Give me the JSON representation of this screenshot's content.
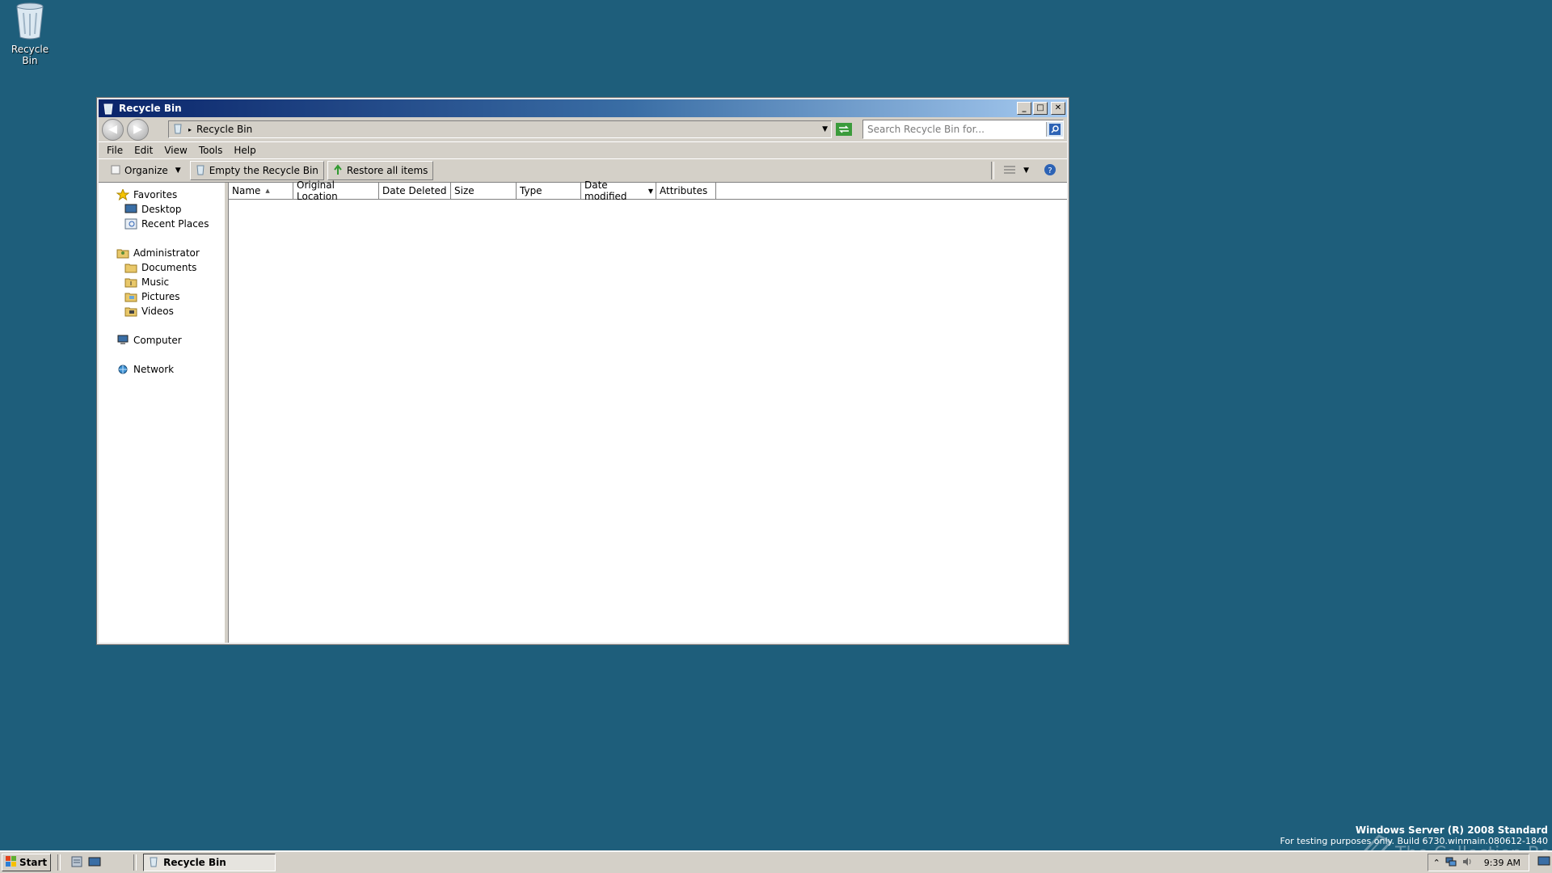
{
  "desktop": {
    "icons": [
      {
        "label": "Recycle Bin",
        "icon": "recycle-bin-icon"
      }
    ],
    "watermark_line1": "Windows Server (R) 2008 Standard",
    "watermark_line2": "For testing purposes only. Build 6730.winmain.080612-1840",
    "brand_text": "The Collection Book"
  },
  "window": {
    "title": "Recycle Bin",
    "controls": {
      "minimize": "_",
      "maximize": "□",
      "close": "✕"
    },
    "address": {
      "text": "Recycle Bin"
    },
    "search": {
      "placeholder": "Search Recycle Bin for..."
    },
    "menu": [
      "File",
      "Edit",
      "View",
      "Tools",
      "Help"
    ],
    "toolbar": {
      "organize": "Organize",
      "empty": "Empty the Recycle Bin",
      "restore": "Restore all items"
    },
    "nav": {
      "favorites": "Favorites",
      "desktop": "Desktop",
      "recent": "Recent Places",
      "administrator": "Administrator",
      "documents": "Documents",
      "music": "Music",
      "pictures": "Pictures",
      "videos": "Videos",
      "computer": "Computer",
      "network": "Network"
    },
    "columns": [
      "Name",
      "Original Location",
      "Date Deleted",
      "Size",
      "Type",
      "Date modified",
      "Attributes"
    ]
  },
  "taskbar": {
    "start": "Start",
    "task_item": "Recycle Bin",
    "clock": "9:39 AM"
  },
  "colors": {
    "desktop": "#1e5e7b",
    "title_start": "#0a246a",
    "title_end": "#a6caf0",
    "chrome": "#d4d0c8"
  }
}
